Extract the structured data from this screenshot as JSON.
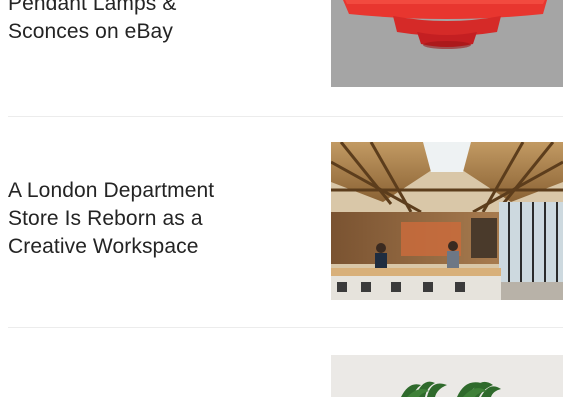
{
  "articles": [
    {
      "title": "Pendant Lamps &\nSconces on eBay",
      "image": "red-pendant-lamp-photo"
    },
    {
      "title": "A London Department\nStore Is Reborn as a\nCreative Workspace",
      "image": "timber-roof-workspace-photo"
    },
    {
      "title": "",
      "image": "palm-plants-photo"
    }
  ]
}
